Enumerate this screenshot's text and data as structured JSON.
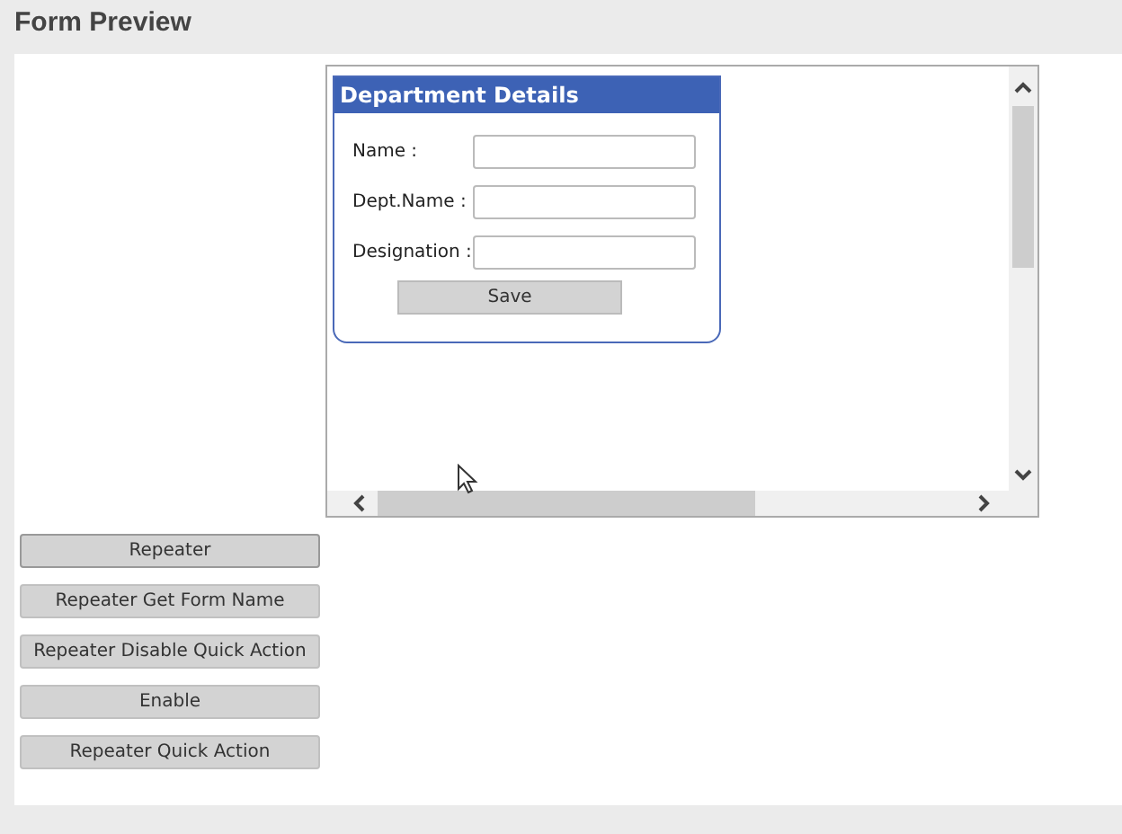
{
  "page": {
    "title": "Form Preview"
  },
  "form": {
    "title": "Department Details",
    "fields": [
      {
        "label": "Name :"
      },
      {
        "label": "Dept.Name :"
      },
      {
        "label": "Designation :"
      }
    ],
    "submit": "Save"
  },
  "buttons": [
    {
      "label": "Repeater"
    },
    {
      "label": "Repeater Get Form Name"
    },
    {
      "label": "Repeater Disable Quick Action"
    },
    {
      "label": "Enable"
    },
    {
      "label": "Repeater Quick Action"
    }
  ]
}
